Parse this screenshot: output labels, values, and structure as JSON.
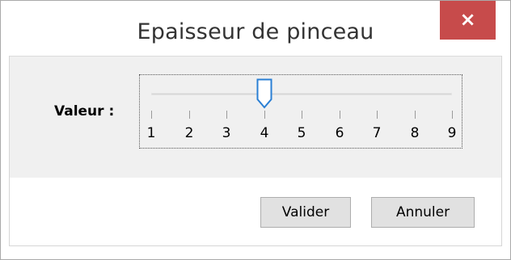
{
  "dialog": {
    "title": "Epaisseur de pinceau",
    "close_label": "×"
  },
  "slider": {
    "label": "Valeur :",
    "min": 1,
    "max": 9,
    "value": 4,
    "tick_labels": [
      "1",
      "2",
      "3",
      "4",
      "5",
      "6",
      "7",
      "8",
      "9"
    ]
  },
  "buttons": {
    "ok_label": "Valider",
    "cancel_label": "Annuler"
  },
  "colors": {
    "close_bg": "#c74b4b",
    "thumb_stroke": "#2a7fd4",
    "panel_bg": "#f0f0f0"
  }
}
